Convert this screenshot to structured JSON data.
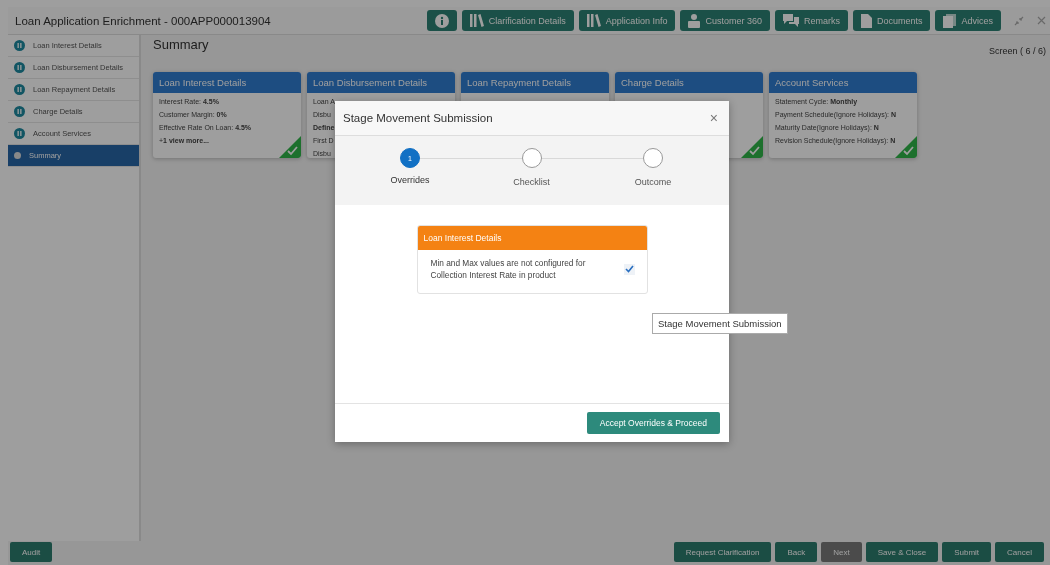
{
  "window": {
    "title": "Loan Application Enrichment - 000APP000013904"
  },
  "header_buttons": [
    {
      "kind": "info"
    },
    {
      "kind": "books",
      "label": "Clarification Details"
    },
    {
      "kind": "books",
      "label": "Application Info"
    },
    {
      "kind": "person",
      "label": "Customer 360"
    },
    {
      "kind": "chat",
      "label": "Remarks"
    },
    {
      "kind": "document",
      "label": "Documents"
    },
    {
      "kind": "stack",
      "label": "Advices"
    }
  ],
  "sidebar": {
    "items": [
      {
        "label": "Loan Interest Details",
        "selected": false
      },
      {
        "label": "Loan Disbursement Details",
        "selected": false
      },
      {
        "label": "Loan Repayment Details",
        "selected": false
      },
      {
        "label": "Charge Details",
        "selected": false
      },
      {
        "label": "Account Services",
        "selected": false
      },
      {
        "label": "Summary",
        "selected": true
      }
    ]
  },
  "page": {
    "title": "Summary",
    "screen": "Screen ( 6 / 6)"
  },
  "cards": [
    {
      "title": "Loan Interest Details",
      "completed": true,
      "lines": [
        "Interest Rate: **4.5%**",
        "Customer Margin: **0%**",
        "Effective Rate On Loan: **4.5%**",
        "+**1 view more...**"
      ]
    },
    {
      "title": "Loan Disbursement Details",
      "lines": [
        "Loan A",
        "Disbu",
        "**Define**",
        "First D",
        "Disbu"
      ]
    },
    {
      "title": "Loan Repayment Details"
    },
    {
      "title": "Charge Details",
      "completed": true
    },
    {
      "title": "Account Services",
      "completed": true,
      "lines": [
        "Statement Cycle: **Monthly**",
        "Payment Schedule(Ignore Holidays): **N**",
        "Maturity Date(Ignore Holidays): **N**",
        "Revision Schedule(Ignore Holidays): **N**"
      ]
    }
  ],
  "modal": {
    "title": "Stage Movement Submission",
    "close": "×",
    "steps": [
      {
        "label": "Overrides",
        "number": "1",
        "selected": true
      },
      {
        "label": "Checklist",
        "selected": false
      },
      {
        "label": "Outcome",
        "selected": false
      }
    ],
    "override_group": {
      "title": "Loan Interest Details",
      "items": [
        {
          "text": "Min and Max values are not configured for Collection Interest Rate in product",
          "checked": true
        }
      ]
    },
    "primary_button": "Accept Overrides & Proceed"
  },
  "tooltip": "Stage Movement Submission",
  "footer": {
    "left": [
      {
        "label": "Audit",
        "disabled": false
      }
    ],
    "right": [
      {
        "label": "Request Clarification",
        "disabled": false
      },
      {
        "label": "Back",
        "disabled": false
      },
      {
        "label": "Next",
        "disabled": true
      },
      {
        "label": "Save & Close",
        "disabled": false
      },
      {
        "label": "Submit",
        "disabled": false
      },
      {
        "label": "Cancel",
        "disabled": false
      }
    ]
  }
}
